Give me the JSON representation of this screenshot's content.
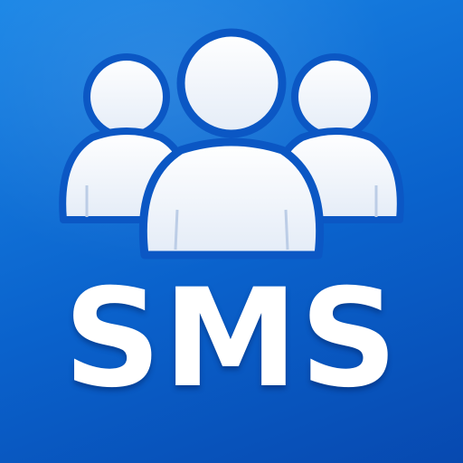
{
  "icon": {
    "label": "SMS",
    "graphic": "group-of-people-icon",
    "colors": {
      "background_top": "#1a86e6",
      "background_bottom": "#0749b0",
      "foreground": "#ffffff",
      "outline": "#0b57c4"
    }
  }
}
